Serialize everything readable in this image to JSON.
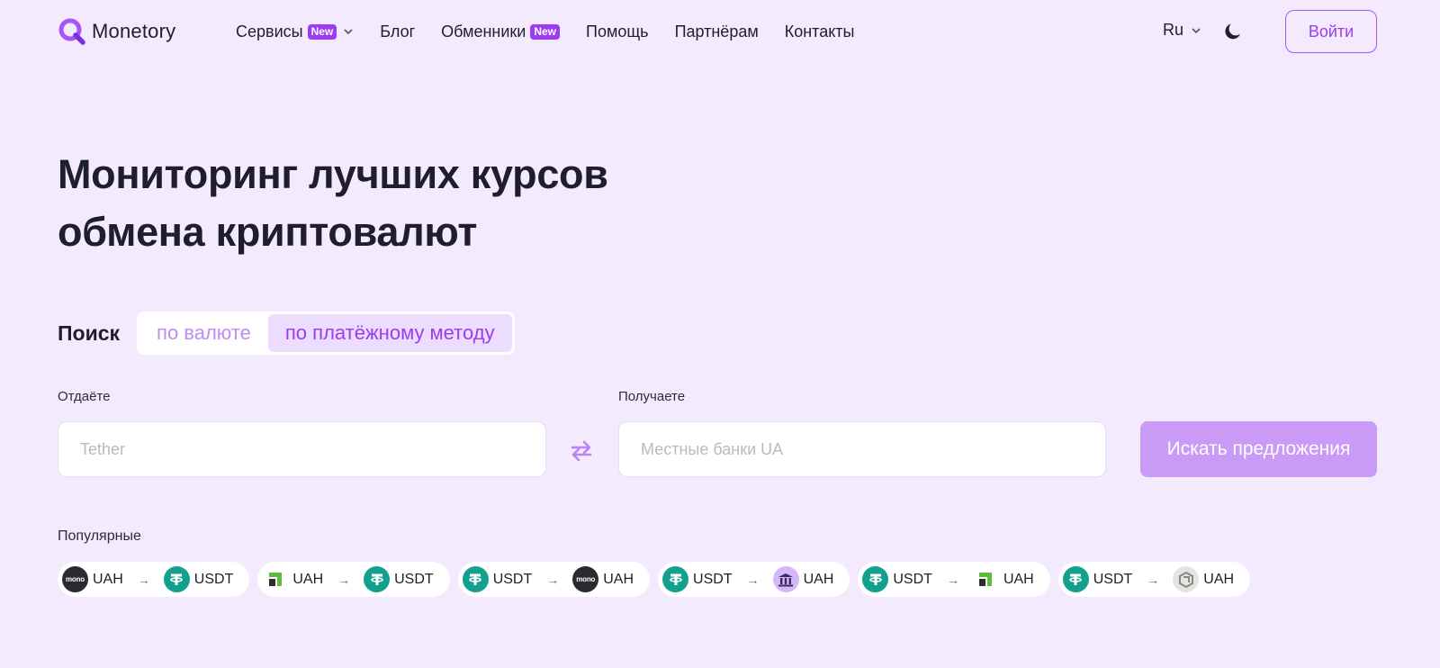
{
  "brand": {
    "name": "Monetory"
  },
  "nav": {
    "items": [
      {
        "label": "Сервисы",
        "badge": "New",
        "dropdown": true
      },
      {
        "label": "Блог"
      },
      {
        "label": "Обменники",
        "badge": "New"
      },
      {
        "label": "Помощь"
      },
      {
        "label": "Партнёрам"
      },
      {
        "label": "Контакты"
      }
    ],
    "lang": "Ru",
    "login_label": "Войти"
  },
  "hero": {
    "line1": "Мониторинг лучших курсов",
    "line2": "обмена криптовалют"
  },
  "search": {
    "label": "Поиск",
    "modes": [
      "по валюте",
      "по платёжному методу"
    ],
    "active_mode": "по платёжному методу",
    "give_label": "Отдаёте",
    "give_placeholder": "Tether",
    "receive_label": "Получаете",
    "receive_placeholder": "Местные банки UA",
    "submit_label": "Искать предложения"
  },
  "popular": {
    "label": "Популярные",
    "pairs": [
      {
        "from": {
          "icon": "mono-icon",
          "code": "UAH"
        },
        "to": {
          "icon": "tether-icon",
          "code": "USDT"
        }
      },
      {
        "from": {
          "icon": "privat-icon",
          "code": "UAH"
        },
        "to": {
          "icon": "tether-icon",
          "code": "USDT"
        }
      },
      {
        "from": {
          "icon": "tether-icon",
          "code": "USDT"
        },
        "to": {
          "icon": "mono-icon",
          "code": "UAH"
        }
      },
      {
        "from": {
          "icon": "tether-icon",
          "code": "USDT"
        },
        "to": {
          "icon": "bank-icon",
          "code": "UAH"
        }
      },
      {
        "from": {
          "icon": "tether-icon",
          "code": "USDT"
        },
        "to": {
          "icon": "privat-icon",
          "code": "UAH"
        }
      },
      {
        "from": {
          "icon": "tether-icon",
          "code": "USDT"
        },
        "to": {
          "icon": "gear-bank-icon",
          "code": "UAH"
        }
      }
    ],
    "arrow": "→"
  },
  "colors": {
    "background": "#f3eafe",
    "accent": "#9b3cf2",
    "button_disabled": "#c99bf7",
    "tether": "#14a08f"
  }
}
